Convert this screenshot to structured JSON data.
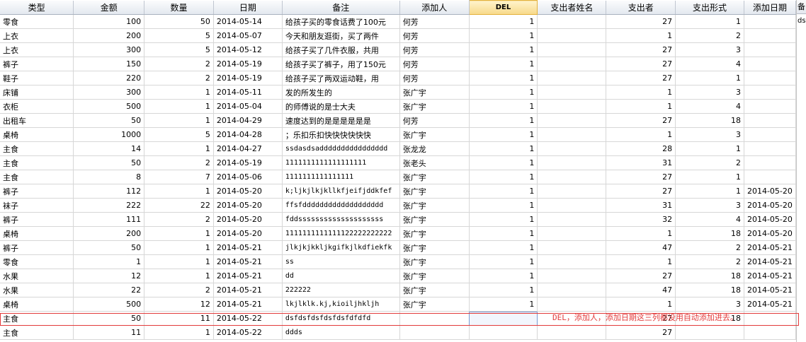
{
  "columns": [
    "类型",
    "金额",
    "数量",
    "日期",
    "备注",
    "添加人",
    "DEL",
    "支出者姓名",
    "支出者",
    "支出形式",
    "添加日期",
    "备"
  ],
  "rows": [
    [
      "零食",
      "100",
      "50",
      "2014-05-14",
      "给孩子买的零食话费了100元",
      "何芳",
      "1",
      "",
      "27",
      "1",
      ""
    ],
    [
      "上衣",
      "200",
      "5",
      "2014-05-07",
      "今天和朋友逛街，买了两件",
      "何芳",
      "1",
      "",
      "1",
      "2",
      ""
    ],
    [
      "上衣",
      "300",
      "5",
      "2014-05-12",
      "给孩子买了几件衣服，共用",
      "何芳",
      "1",
      "",
      "27",
      "3",
      ""
    ],
    [
      "裤子",
      "150",
      "2",
      "2014-05-19",
      "给孩子买了裤子，用了150元",
      "何芳",
      "1",
      "",
      "27",
      "4",
      ""
    ],
    [
      "鞋子",
      "220",
      "2",
      "2014-05-19",
      "给孩子买了两双运动鞋，用",
      "何芳",
      "1",
      "",
      "27",
      "1",
      ""
    ],
    [
      "床铺",
      "300",
      "1",
      "2014-05-11",
      "发的所发生的",
      "张广宇",
      "1",
      "",
      "1",
      "3",
      ""
    ],
    [
      "衣柜",
      "500",
      "1",
      "2014-05-04",
      "的师傅说的是士大夫",
      "张广宇",
      "1",
      "",
      "1",
      "4",
      ""
    ],
    [
      "出租车",
      "50",
      "1",
      "2014-04-29",
      "速度达到的是是是是是是",
      "何芳",
      "1",
      "",
      "27",
      "18",
      ""
    ],
    [
      "桌椅",
      "1000",
      "5",
      "2014-04-28",
      "；乐扣乐扣快快快快快快",
      "张广宇",
      "1",
      "",
      "1",
      "3",
      ""
    ],
    [
      "主食",
      "14",
      "1",
      "2014-04-27",
      "ssdasdsadddddddddddddddd",
      "张龙龙",
      "1",
      "",
      "28",
      "1",
      ""
    ],
    [
      "主食",
      "50",
      "2",
      "2014-05-19",
      "1111111111111111111",
      "张老头",
      "1",
      "",
      "31",
      "2",
      ""
    ],
    [
      "主食",
      "8",
      "7",
      "2014-05-06",
      "1111111111111111",
      "张广宇",
      "1",
      "",
      "27",
      "1",
      ""
    ],
    [
      "裤子",
      "112",
      "1",
      "2014-05-20",
      "k;ljkjlkjkllkfjeifjddkfef",
      "张广宇",
      "1",
      "",
      "27",
      "1",
      "2014-05-20"
    ],
    [
      "袜子",
      "222",
      "22",
      "2014-05-20",
      "ffsfddddddddddddddddddd",
      "张广宇",
      "1",
      "",
      "31",
      "3",
      "2014-05-20"
    ],
    [
      "裤子",
      "111",
      "2",
      "2014-05-20",
      "fddssssssssssssssssssss",
      "张广宇",
      "1",
      "",
      "32",
      "4",
      "2014-05-20"
    ],
    [
      "桌椅",
      "200",
      "1",
      "2014-05-20",
      "1111111111111122222222222",
      "张广宇",
      "1",
      "",
      "1",
      "18",
      "2014-05-20"
    ],
    [
      "裤子",
      "50",
      "1",
      "2014-05-21",
      "jlkjkjkkljkgifkjlkdfiekfk",
      "张广宇",
      "1",
      "",
      "47",
      "2",
      "2014-05-21"
    ],
    [
      "零食",
      "1",
      "1",
      "2014-05-21",
      "ss",
      "张广宇",
      "1",
      "",
      "1",
      "2",
      "2014-05-21"
    ],
    [
      "水果",
      "12",
      "1",
      "2014-05-21",
      "dd",
      "张广宇",
      "1",
      "",
      "27",
      "18",
      "2014-05-21"
    ],
    [
      "水果",
      "22",
      "2",
      "2014-05-21",
      "222222",
      "张广宇",
      "1",
      "",
      "47",
      "18",
      "2014-05-21"
    ],
    [
      "桌椅",
      "500",
      "12",
      "2014-05-21",
      "lkjlklk.kj,kioiljhkljh",
      "张广宇",
      "1",
      "",
      "1",
      "3",
      "2014-05-21"
    ],
    [
      "主食",
      "50",
      "11",
      "2014-05-22",
      "dsfdsfdsfdsfdsfdfdfd",
      "",
      "",
      "",
      "27",
      "18",
      ""
    ],
    [
      "主食",
      "11",
      "1",
      "2014-05-22",
      "ddds",
      "",
      "",
      "",
      "27",
      "",
      ""
    ]
  ],
  "side_cell": "ds",
  "note": "DEL，添加人，添加日期这三列都没用自动添加进去。"
}
